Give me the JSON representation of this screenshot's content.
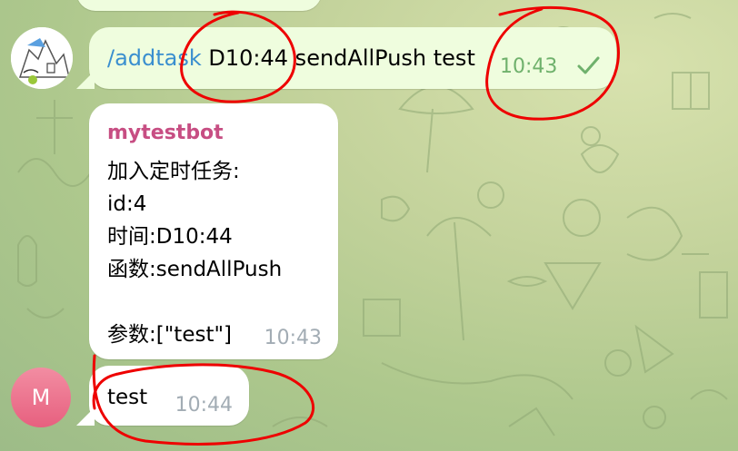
{
  "chat": {
    "messages": [
      {
        "sender": "me",
        "text_command": "/addtask",
        "text_rest": " D10:44 sendAllPush test",
        "time": "10:43",
        "status_icon": "check-icon"
      },
      {
        "sender": "bot",
        "sender_name": "mytestbot",
        "lines": [
          "加入定时任务:",
          "id:4",
          "时间:D10:44",
          "函数:sendAllPush",
          "",
          "参数:[\"test\"]"
        ],
        "time": "10:43"
      },
      {
        "sender": "user",
        "avatar_letter": "M",
        "text": "test",
        "time": "10:44"
      }
    ]
  },
  "colors": {
    "outgoing_bubble": "#effdde",
    "incoming_bubble": "#ffffff",
    "command_link": "#3a8fcf",
    "bot_name": "#c74e83",
    "outgoing_time": "#6fb16c",
    "incoming_time": "#a2acb4",
    "avatar_m": "#e7607f",
    "annotation": "#ee0000"
  }
}
